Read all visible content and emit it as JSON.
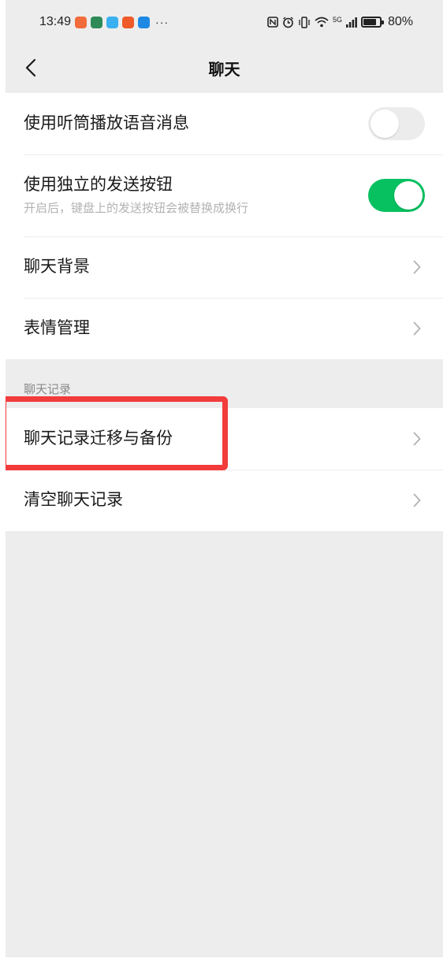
{
  "status_bar": {
    "time": "13:49",
    "more": "···",
    "network": "5G",
    "battery": "80%",
    "battery_level": 0.8,
    "app_icons": [
      "#f26b3a",
      "#2e8b57",
      "#3ab0f0",
      "#f05a28",
      "#1e88e5"
    ]
  },
  "nav": {
    "title": "聊天",
    "back_icon": "chevron-left-icon"
  },
  "settings": {
    "earpiece": {
      "label": "使用听筒播放语音消息",
      "enabled": false
    },
    "send_button": {
      "label": "使用独立的发送按钮",
      "description": "开启后，键盘上的发送按钮会被替换成换行",
      "enabled": true
    },
    "chat_background": {
      "label": "聊天背景"
    },
    "sticker_management": {
      "label": "表情管理"
    }
  },
  "chat_history": {
    "section_title": "聊天记录",
    "migrate_backup": {
      "label": "聊天记录迁移与备份"
    },
    "clear": {
      "label": "清空聊天记录"
    }
  },
  "colors": {
    "accent_green": "#07c160",
    "highlight_red": "#f23b3b",
    "background": "#ededed"
  }
}
